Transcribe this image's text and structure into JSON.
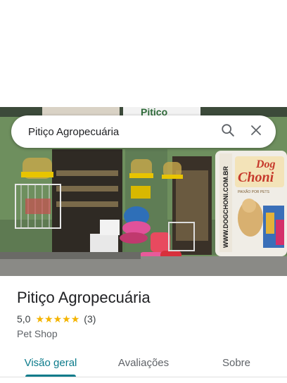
{
  "search": {
    "query": "Pitiço Agropecuária",
    "search_icon": "search-icon",
    "clear_icon": "close-icon"
  },
  "photo": {
    "sign_text": "Pitiço",
    "banner_brand_line1": "Dog",
    "banner_brand_line2": "Choni",
    "banner_tagline": "PAIXÃO POR PETS",
    "banner_url": "WWW.DOGCHONI.COM.BR"
  },
  "place": {
    "name": "Pitiço Agropecuária",
    "rating": "5,0",
    "stars": 5,
    "review_count": "(3)",
    "category": "Pet Shop"
  },
  "tabs": [
    {
      "label": "Visão geral",
      "active": true
    },
    {
      "label": "Avaliações",
      "active": false
    },
    {
      "label": "Sobre",
      "active": false
    }
  ],
  "colors": {
    "accent": "#0b7b8b",
    "star": "#f4b400"
  }
}
